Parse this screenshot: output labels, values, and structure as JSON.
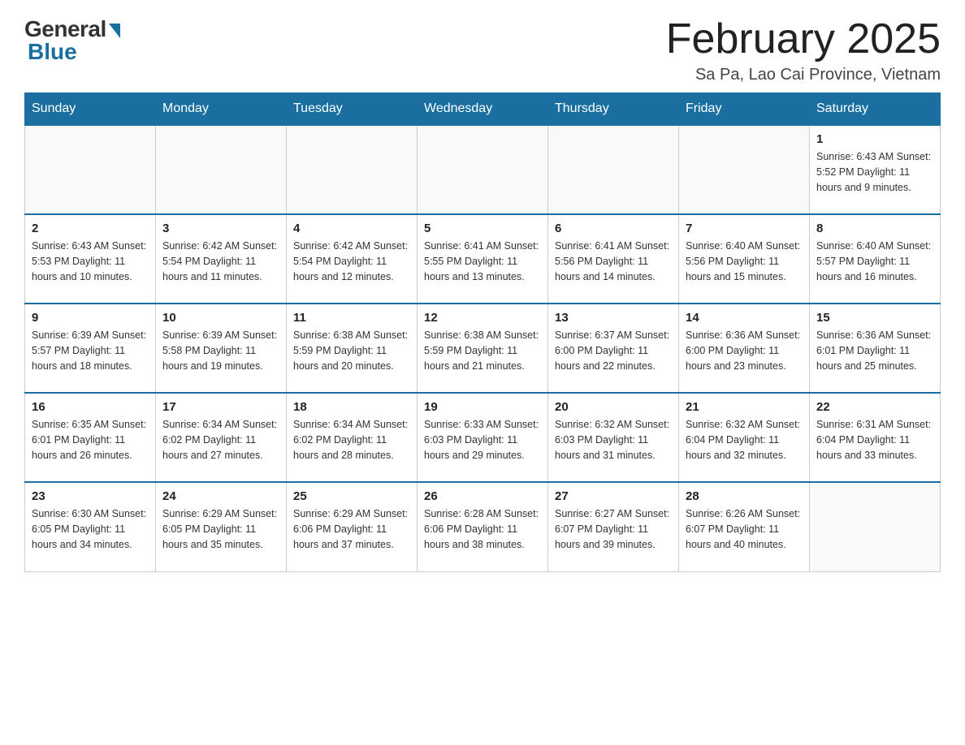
{
  "header": {
    "logo_general": "General",
    "logo_blue": "Blue",
    "title": "February 2025",
    "location": "Sa Pa, Lao Cai Province, Vietnam"
  },
  "days_of_week": [
    "Sunday",
    "Monday",
    "Tuesday",
    "Wednesday",
    "Thursday",
    "Friday",
    "Saturday"
  ],
  "weeks": [
    [
      {
        "day": "",
        "info": ""
      },
      {
        "day": "",
        "info": ""
      },
      {
        "day": "",
        "info": ""
      },
      {
        "day": "",
        "info": ""
      },
      {
        "day": "",
        "info": ""
      },
      {
        "day": "",
        "info": ""
      },
      {
        "day": "1",
        "info": "Sunrise: 6:43 AM\nSunset: 5:52 PM\nDaylight: 11 hours and 9 minutes."
      }
    ],
    [
      {
        "day": "2",
        "info": "Sunrise: 6:43 AM\nSunset: 5:53 PM\nDaylight: 11 hours and 10 minutes."
      },
      {
        "day": "3",
        "info": "Sunrise: 6:42 AM\nSunset: 5:54 PM\nDaylight: 11 hours and 11 minutes."
      },
      {
        "day": "4",
        "info": "Sunrise: 6:42 AM\nSunset: 5:54 PM\nDaylight: 11 hours and 12 minutes."
      },
      {
        "day": "5",
        "info": "Sunrise: 6:41 AM\nSunset: 5:55 PM\nDaylight: 11 hours and 13 minutes."
      },
      {
        "day": "6",
        "info": "Sunrise: 6:41 AM\nSunset: 5:56 PM\nDaylight: 11 hours and 14 minutes."
      },
      {
        "day": "7",
        "info": "Sunrise: 6:40 AM\nSunset: 5:56 PM\nDaylight: 11 hours and 15 minutes."
      },
      {
        "day": "8",
        "info": "Sunrise: 6:40 AM\nSunset: 5:57 PM\nDaylight: 11 hours and 16 minutes."
      }
    ],
    [
      {
        "day": "9",
        "info": "Sunrise: 6:39 AM\nSunset: 5:57 PM\nDaylight: 11 hours and 18 minutes."
      },
      {
        "day": "10",
        "info": "Sunrise: 6:39 AM\nSunset: 5:58 PM\nDaylight: 11 hours and 19 minutes."
      },
      {
        "day": "11",
        "info": "Sunrise: 6:38 AM\nSunset: 5:59 PM\nDaylight: 11 hours and 20 minutes."
      },
      {
        "day": "12",
        "info": "Sunrise: 6:38 AM\nSunset: 5:59 PM\nDaylight: 11 hours and 21 minutes."
      },
      {
        "day": "13",
        "info": "Sunrise: 6:37 AM\nSunset: 6:00 PM\nDaylight: 11 hours and 22 minutes."
      },
      {
        "day": "14",
        "info": "Sunrise: 6:36 AM\nSunset: 6:00 PM\nDaylight: 11 hours and 23 minutes."
      },
      {
        "day": "15",
        "info": "Sunrise: 6:36 AM\nSunset: 6:01 PM\nDaylight: 11 hours and 25 minutes."
      }
    ],
    [
      {
        "day": "16",
        "info": "Sunrise: 6:35 AM\nSunset: 6:01 PM\nDaylight: 11 hours and 26 minutes."
      },
      {
        "day": "17",
        "info": "Sunrise: 6:34 AM\nSunset: 6:02 PM\nDaylight: 11 hours and 27 minutes."
      },
      {
        "day": "18",
        "info": "Sunrise: 6:34 AM\nSunset: 6:02 PM\nDaylight: 11 hours and 28 minutes."
      },
      {
        "day": "19",
        "info": "Sunrise: 6:33 AM\nSunset: 6:03 PM\nDaylight: 11 hours and 29 minutes."
      },
      {
        "day": "20",
        "info": "Sunrise: 6:32 AM\nSunset: 6:03 PM\nDaylight: 11 hours and 31 minutes."
      },
      {
        "day": "21",
        "info": "Sunrise: 6:32 AM\nSunset: 6:04 PM\nDaylight: 11 hours and 32 minutes."
      },
      {
        "day": "22",
        "info": "Sunrise: 6:31 AM\nSunset: 6:04 PM\nDaylight: 11 hours and 33 minutes."
      }
    ],
    [
      {
        "day": "23",
        "info": "Sunrise: 6:30 AM\nSunset: 6:05 PM\nDaylight: 11 hours and 34 minutes."
      },
      {
        "day": "24",
        "info": "Sunrise: 6:29 AM\nSunset: 6:05 PM\nDaylight: 11 hours and 35 minutes."
      },
      {
        "day": "25",
        "info": "Sunrise: 6:29 AM\nSunset: 6:06 PM\nDaylight: 11 hours and 37 minutes."
      },
      {
        "day": "26",
        "info": "Sunrise: 6:28 AM\nSunset: 6:06 PM\nDaylight: 11 hours and 38 minutes."
      },
      {
        "day": "27",
        "info": "Sunrise: 6:27 AM\nSunset: 6:07 PM\nDaylight: 11 hours and 39 minutes."
      },
      {
        "day": "28",
        "info": "Sunrise: 6:26 AM\nSunset: 6:07 PM\nDaylight: 11 hours and 40 minutes."
      },
      {
        "day": "",
        "info": ""
      }
    ]
  ]
}
